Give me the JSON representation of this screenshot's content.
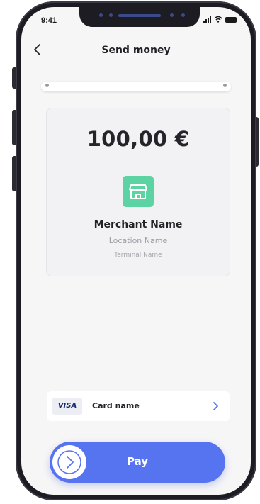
{
  "status_bar": {
    "time": "9:41"
  },
  "header": {
    "title": "Send money",
    "back_icon": "chevron-left-icon"
  },
  "progress": {
    "fraction": 1.0
  },
  "merchant": {
    "amount": "100,00 €",
    "icon": "store-icon",
    "icon_color": "#5bd3a2",
    "name": "Merchant Name",
    "location": "Location Name",
    "terminal": "Terminal Name"
  },
  "payment_card": {
    "brand": "VISA",
    "name": "Card name",
    "chevron_icon": "chevron-right-icon"
  },
  "pay_button": {
    "label": "Pay",
    "accent_color": "#5673f0",
    "knob_icon": "chevron-right-icon"
  }
}
